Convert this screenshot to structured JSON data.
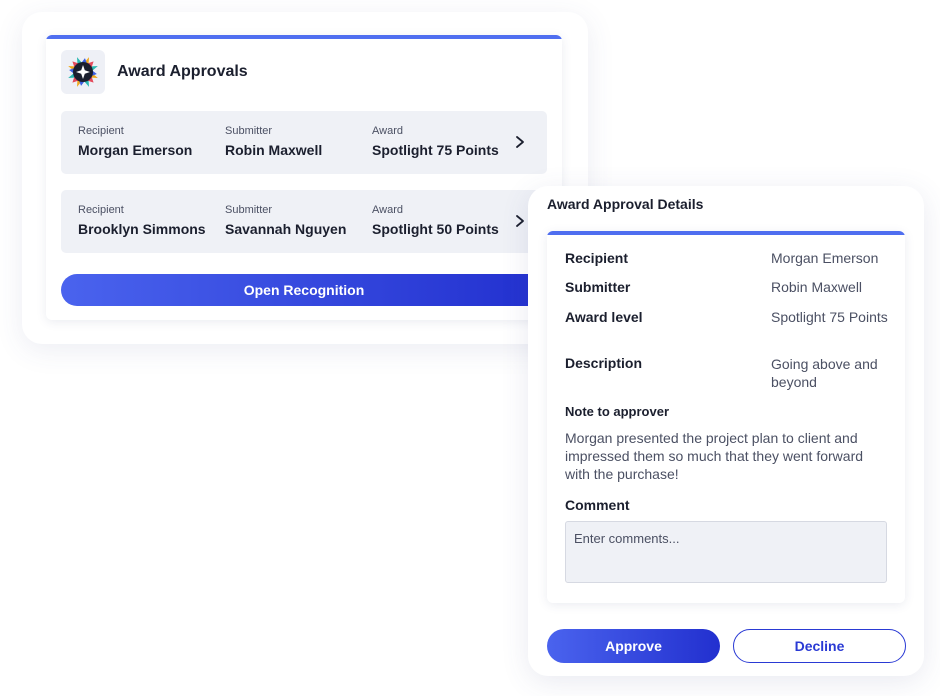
{
  "approvals": {
    "title": "Award Approvals",
    "rows": [
      {
        "recipient_label": "Recipient",
        "recipient": "Morgan Emerson",
        "submitter_label": "Submitter",
        "submitter": "Robin Maxwell",
        "award_label": "Award",
        "award": "Spotlight 75 Points"
      },
      {
        "recipient_label": "Recipient",
        "recipient": "Brooklyn Simmons",
        "submitter_label": "Submitter",
        "submitter": "Savannah Nguyen",
        "award_label": "Award",
        "award": "Spotlight 50 Points"
      }
    ],
    "open_button": "Open Recognition"
  },
  "details": {
    "title": "Award Approval Details",
    "recipient_label": "Recipient",
    "recipient": "Morgan Emerson",
    "submitter_label": "Submitter",
    "submitter": "Robin Maxwell",
    "award_level_label": "Award level",
    "award_level": "Spotlight 75 Points",
    "description_label": "Description",
    "description": "Going above and beyond",
    "note_label": "Note to approver",
    "note": "Morgan presented the project plan to client and impressed them so much that they went forward with the purchase!",
    "comment_label": "Comment",
    "comment_placeholder": "Enter comments...",
    "comment_value": ""
  },
  "actions": {
    "approve": "Approve",
    "decline": "Decline"
  },
  "icons": {
    "logo": "star-award-logo-icon",
    "chevron": "chevron-right-icon"
  },
  "colors": {
    "accent": "#4f6ef0",
    "button_start": "#4a63ee",
    "button_end": "#2230cf",
    "row_bg": "#eff1f6"
  }
}
